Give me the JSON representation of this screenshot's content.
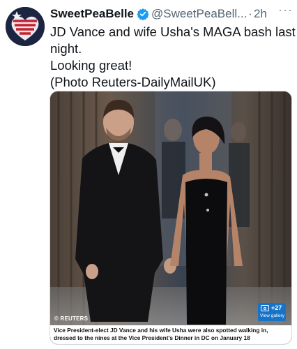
{
  "tweet": {
    "display_name": "SweetPeaBelle",
    "handle": "@SweetPeaBell...",
    "separator": "·",
    "time": "2h",
    "more": "···",
    "text_lines": [
      "JD Vance and wife Usha's MAGA bash last",
      "night.",
      "Looking great!",
      "(Photo Reuters-DailyMailUK)"
    ]
  },
  "media": {
    "credit": "© REUTERS",
    "gallery_count": "+27",
    "gallery_label": "View gallery",
    "caption": "Vice President-elect JD Vance and his wife Usha were also spotted walking in, dressed to the nines at the Vice President's Dinner in DC on January 18"
  },
  "colors": {
    "verified_badge": "#1d9bf0",
    "handle_gray": "#536471",
    "gallery_blue": "#1673c8"
  }
}
